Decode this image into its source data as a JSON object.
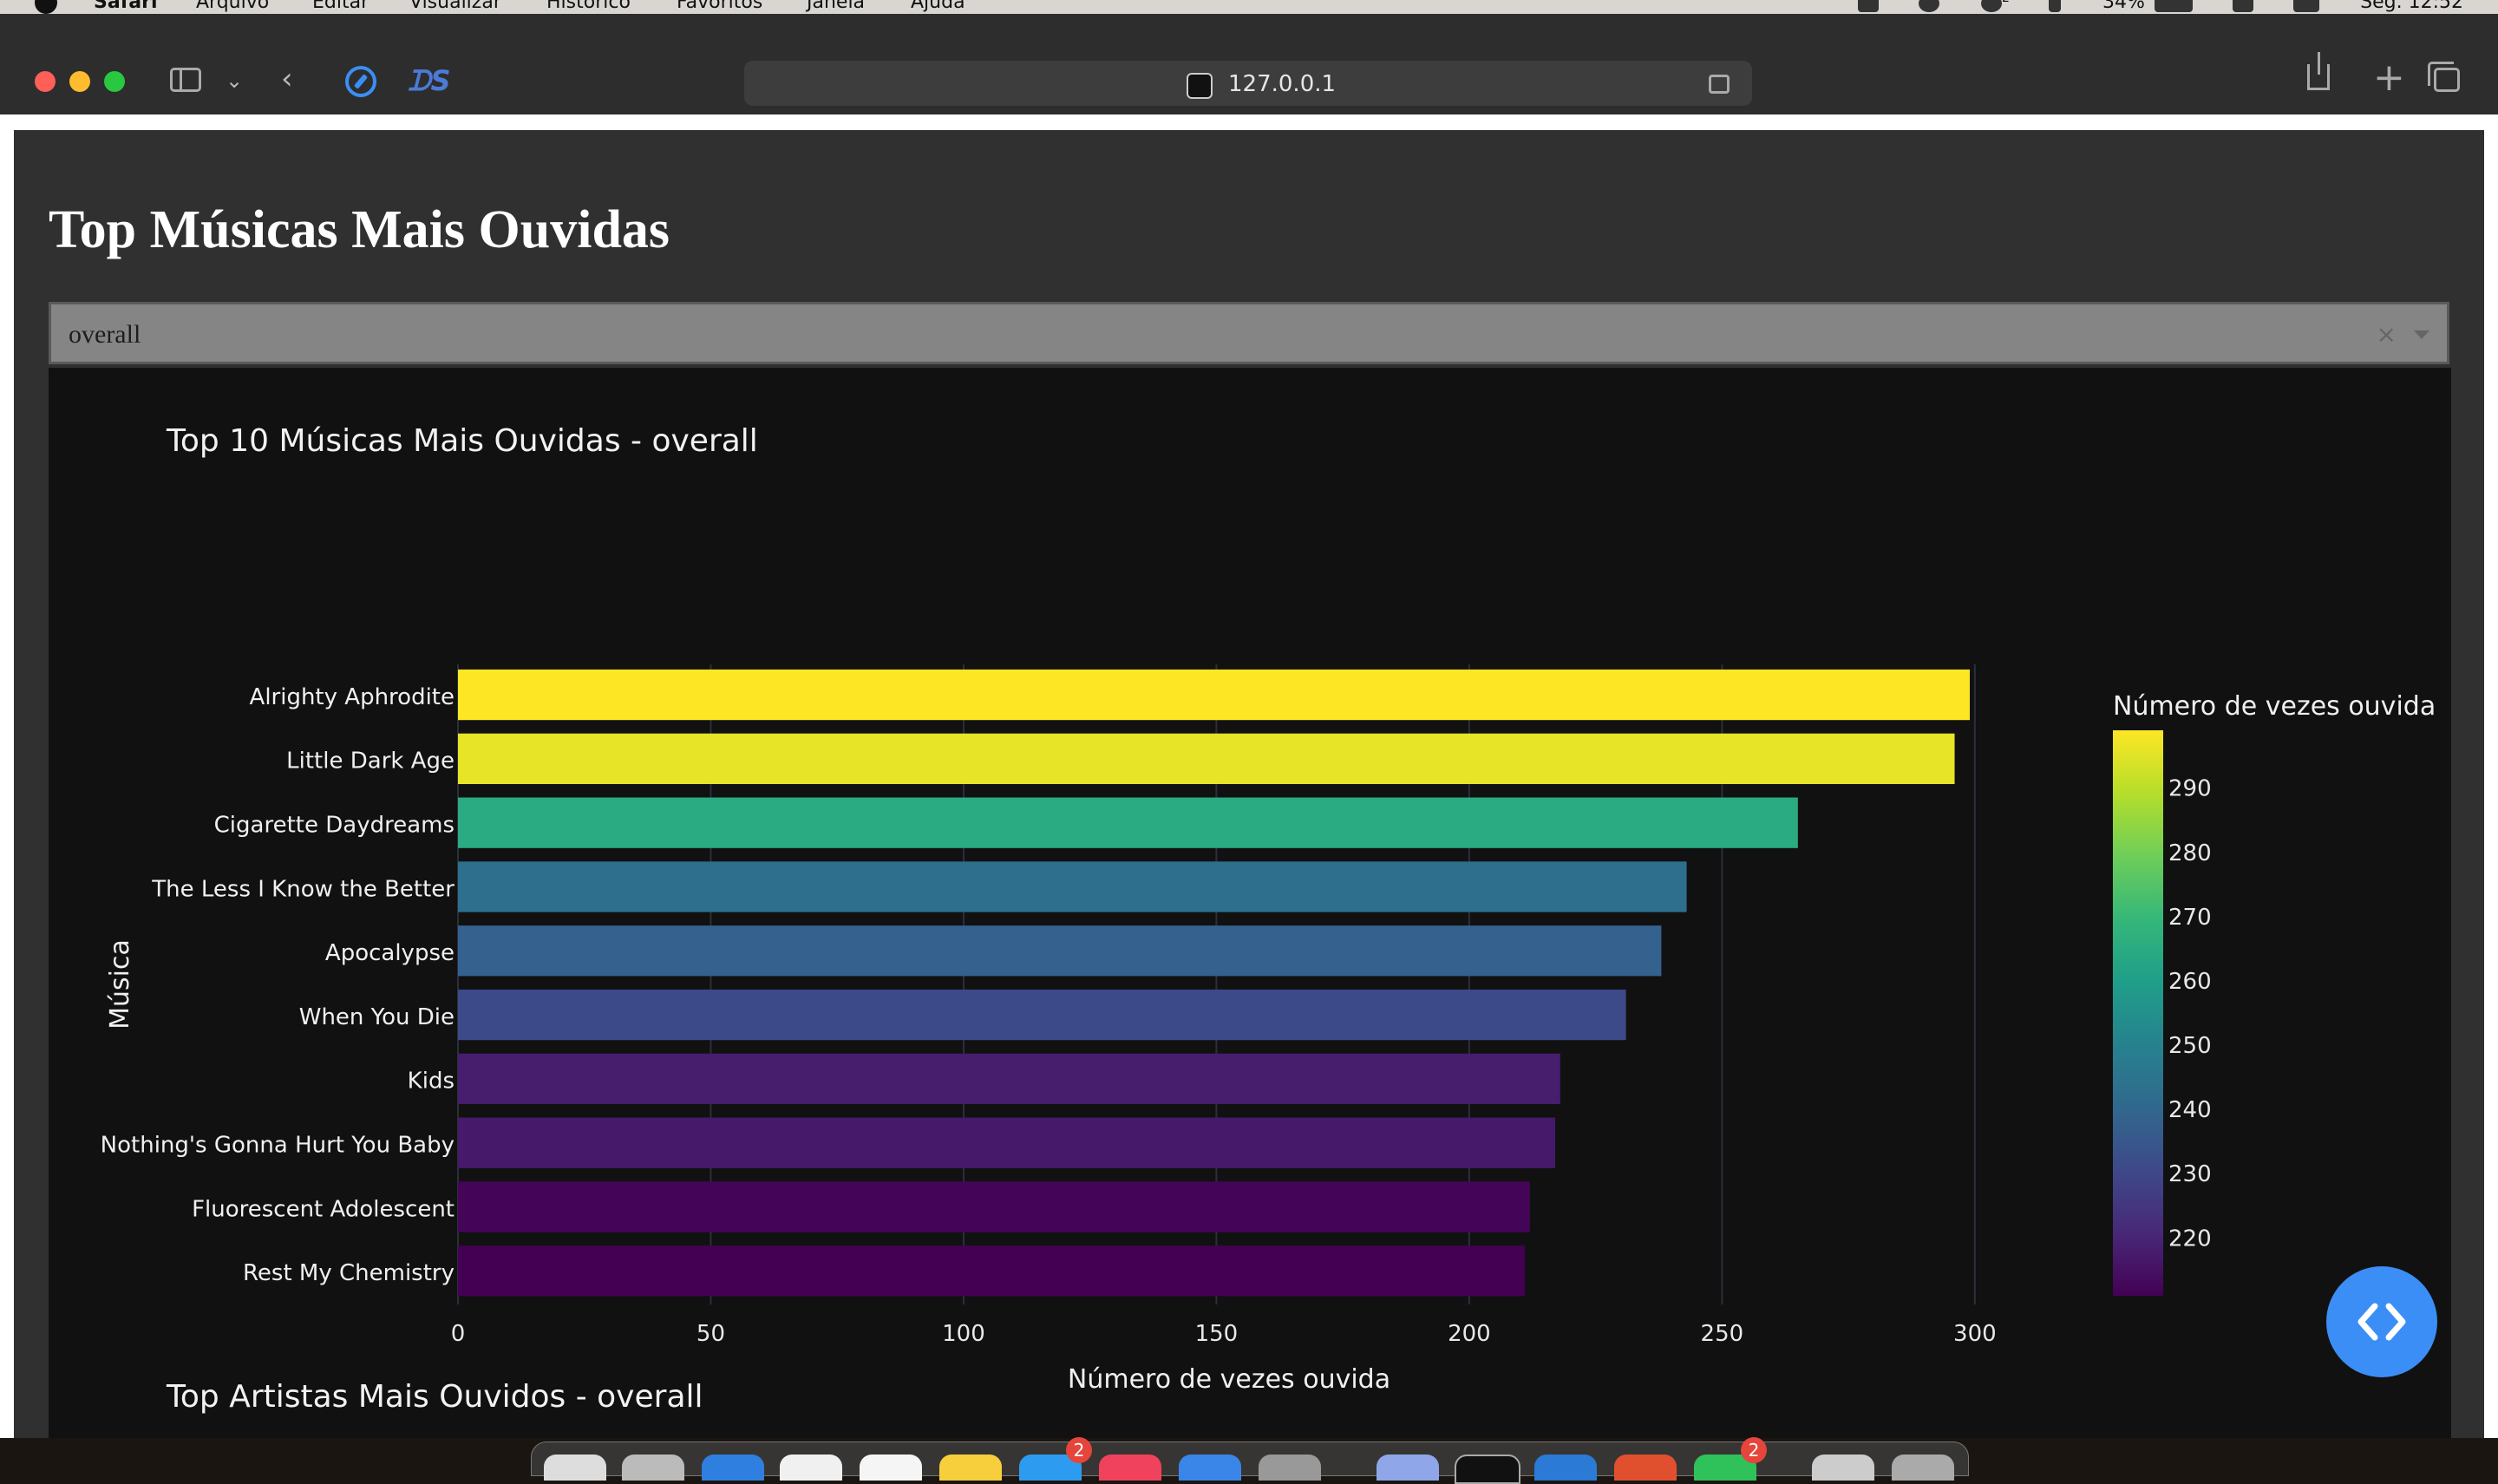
{
  "menubar": {
    "app": "Safari",
    "items": [
      "Arquivo",
      "Editar",
      "Visualizar",
      "Histórico",
      "Favoritos",
      "Janela",
      "Ajuda"
    ],
    "battery": "34%",
    "clock": "Seg. 12:52",
    "notification_badge": "2"
  },
  "browser": {
    "url": "127.0.0.1"
  },
  "page": {
    "title": "Top Músicas Mais Ouvidas",
    "dropdown": {
      "value": "overall"
    }
  },
  "colors": {
    "viridis": [
      "#440154",
      "#482878",
      "#3e4989",
      "#31688e",
      "#26828e",
      "#1f9e89",
      "#35b779",
      "#6ece58",
      "#b5de2b",
      "#fde725"
    ],
    "fab": "#3b8ef5"
  },
  "chart_data": {
    "type": "bar",
    "orientation": "horizontal",
    "title": "Top 10 Músicas Mais Ouvidas - overall",
    "xlabel": "Número de vezes ouvida",
    "ylabel": "Música",
    "xlim": [
      0,
      305
    ],
    "xticks": [
      0,
      50,
      100,
      150,
      200,
      250,
      300
    ],
    "categories": [
      "Alrighty Aphrodite",
      "Little Dark Age",
      "Cigarette Daydreams",
      "The Less I Know the Better",
      "Apocalypse",
      "When You Die",
      "Kids",
      "Nothing's Gonna Hurt You Baby",
      "Fluorescent Adolescent",
      "Rest My Chemistry"
    ],
    "values": [
      299,
      296,
      265,
      243,
      238,
      231,
      218,
      217,
      212,
      211
    ],
    "colorbar": {
      "title": "Número de vezes ouvida",
      "range": [
        211,
        299
      ],
      "ticks": [
        220,
        230,
        240,
        250,
        260,
        270,
        280,
        290
      ],
      "colorscale": "viridis"
    },
    "grid": true,
    "legend": "none"
  },
  "chart2": {
    "title": "Top Artistas Mais Ouvidos - overall"
  },
  "dock": {
    "badges": [
      "2",
      "2"
    ]
  }
}
